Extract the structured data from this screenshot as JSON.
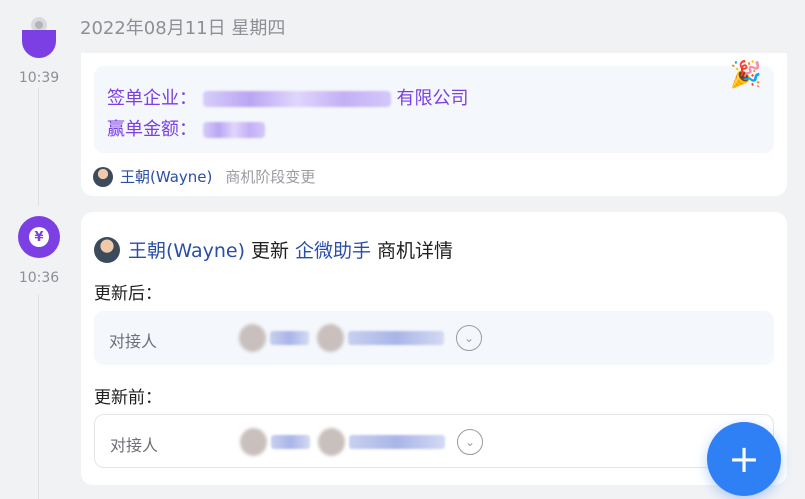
{
  "date_header": "2022年08月11日 星期四",
  "entries": [
    {
      "time": "10:39",
      "sign_company_label": "签单企业：",
      "sign_company_suffix": "有限公司",
      "sign_amount_label": "赢单金额：",
      "user": "王朝(Wayne)",
      "action": "商机阶段变更"
    },
    {
      "time": "10:36",
      "icon": "yen-icon",
      "user": "王朝(Wayne)",
      "verb": "更新",
      "app": "企微助手",
      "object": "商机详情",
      "after_label": "更新后：",
      "before_label": "更新前：",
      "field_name": "对接人"
    }
  ],
  "fab_label": "+",
  "colors": {
    "accent_purple": "#7b3fe4",
    "link_blue": "#2a4ea8",
    "fab_blue": "#2f7ff5"
  }
}
